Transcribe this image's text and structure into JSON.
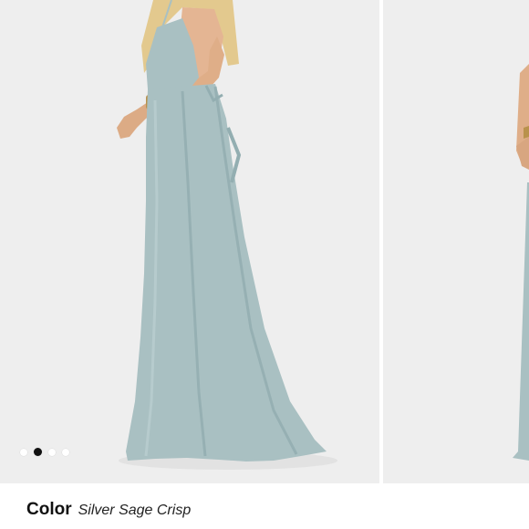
{
  "gallery": {
    "image_description": "model-wearing-sage-maxi-dress",
    "dots": [
      {
        "active": false
      },
      {
        "active": true
      },
      {
        "active": false
      },
      {
        "active": false
      }
    ],
    "active_index": 1
  },
  "product": {
    "color_label": "Color",
    "color_value": "Silver Sage Crisp"
  },
  "colors": {
    "background": "#eeeeee",
    "dress": "#a9c0c2",
    "dress_shadow": "#93aeb1",
    "skin": "#e0b08c",
    "hair": "#e3c98e",
    "dot_active": "#111111",
    "dot_inactive": "#ffffff"
  }
}
